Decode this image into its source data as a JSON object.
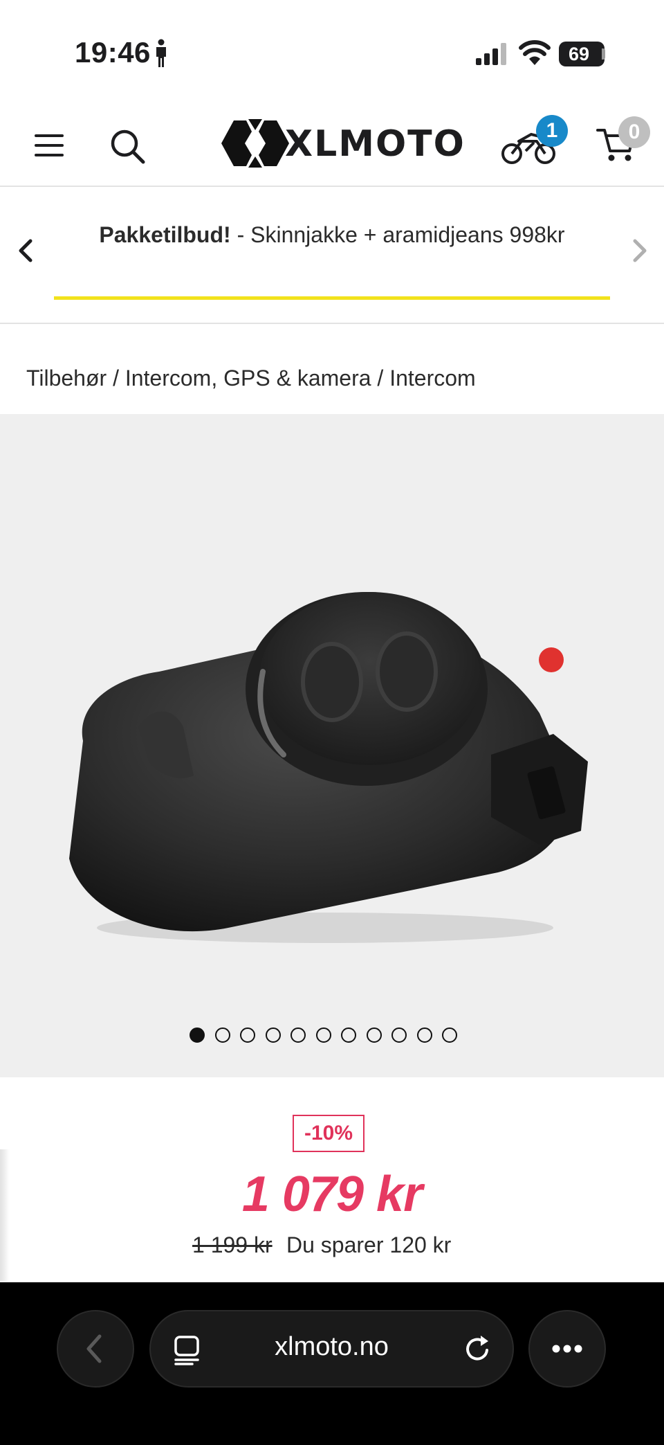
{
  "status": {
    "time": "19:46",
    "battery": "69"
  },
  "header": {
    "logo": "XLMOTO",
    "bike_count": "1",
    "cart_count": "0"
  },
  "promo": {
    "title": "Pakketilbud!",
    "text": " - Skinnjakke + aramidjeans 998kr"
  },
  "breadcrumb": "Tilbehør / Intercom, GPS & kamera / Intercom",
  "gallery": {
    "total_images": 11,
    "active_index": 0
  },
  "price": {
    "discount": "-10%",
    "current": "1 079 kr",
    "old": "1 199 kr",
    "savings": "Du sparer 120 kr"
  },
  "browser": {
    "url": "xlmoto.no"
  },
  "colors": {
    "accent_price": "#e63a62",
    "promo_underline": "#f2e21c",
    "badge_blue": "#1889c9"
  }
}
